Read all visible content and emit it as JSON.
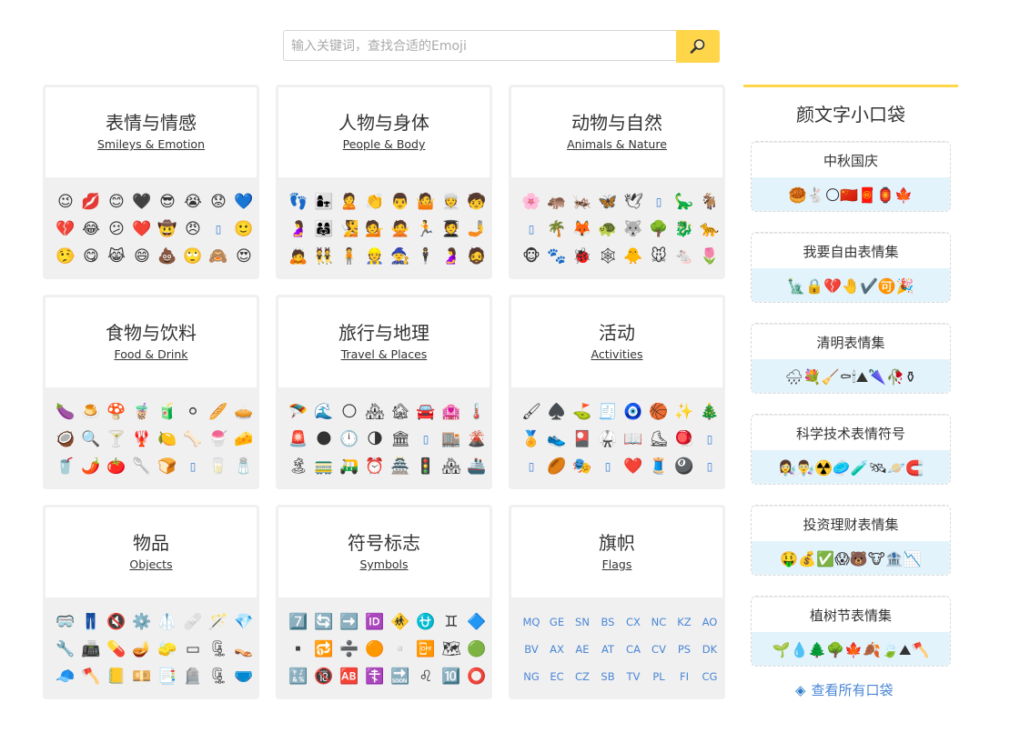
{
  "search": {
    "placeholder": "输入关键词，查找合适的Emoji",
    "button_icon": "magnifier-icon"
  },
  "categories": [
    {
      "title": "表情与情感",
      "sub": "Smileys & Emotion",
      "rows": [
        [
          "😉",
          "💋",
          "😊",
          "🖤",
          "😎",
          "😭",
          "😟",
          "💙"
        ],
        [
          "💔",
          "😂",
          "😕",
          "❤️",
          "🤠",
          "😠",
          "▯",
          "🙂"
        ],
        [
          "🤥",
          "😋",
          "😹",
          "😄",
          "💩",
          "🙄",
          "🙈",
          "😍"
        ]
      ]
    },
    {
      "title": "人物与身体",
      "sub": "People & Body",
      "rows": [
        [
          "👣",
          "👩‍👧",
          "🙎",
          "👏",
          "👨",
          "🤷",
          "👳",
          "🧒"
        ],
        [
          "🤰",
          "👨‍👩‍👧",
          "🧏",
          "💁",
          "🙅",
          "🏃",
          "🧑‍🎓",
          "🤳"
        ],
        [
          "🙇",
          "👯",
          "🧍",
          "👷",
          "🧙",
          "🕴",
          "🤰",
          "🧔"
        ]
      ]
    },
    {
      "title": "动物与自然",
      "sub": "Animals & Nature",
      "rows": [
        [
          "🌸",
          "🦛",
          "🦗",
          "🦋",
          "🕊",
          "▯",
          "🦕",
          "🐐"
        ],
        [
          "▯",
          "🌴",
          "🦊",
          "🐢",
          "🐺",
          "🌳",
          "🐉",
          "🐆"
        ],
        [
          "🐵",
          "🐾",
          "🐞",
          "🕸",
          "🐥",
          "🐭",
          "🐁",
          "🌷"
        ]
      ]
    },
    {
      "title": "食物与饮料",
      "sub": "Food & Drink",
      "rows": [
        [
          "🍆",
          "🍮",
          "🍄",
          "🧋",
          "🧃",
          "⚪",
          "🥖",
          "🥧"
        ],
        [
          "🥥",
          "🔍",
          "🍸",
          "🦞",
          "🍋",
          "🦴",
          "🍧",
          "🧀"
        ],
        [
          "🥤",
          "🌶️",
          "🍅",
          "🥄",
          "🍞",
          "▯",
          "🥛",
          "🧂"
        ]
      ]
    },
    {
      "title": "旅行与地理",
      "sub": "Travel & Places",
      "rows": [
        [
          "🪂",
          "🌊",
          "🌕",
          "🏘",
          "🏚",
          "🚘",
          "🏩",
          "🌡️"
        ],
        [
          "🚨",
          "🌑",
          "🕛",
          "🌗",
          "🏛",
          "▯",
          "🏬",
          "🌋"
        ],
        [
          "🏝",
          "🚃",
          "🛺",
          "⏰",
          "🏯",
          "🚦",
          "🏘",
          "🚢"
        ]
      ]
    },
    {
      "title": "活动",
      "sub": "Activities",
      "rows": [
        [
          "🖌",
          "♠️",
          "⛳",
          "🧾",
          "🧿",
          "🏀",
          "✨",
          "🎄"
        ],
        [
          "🏅",
          "👟",
          "🎴",
          "🥋",
          "📖",
          "⛸",
          "🪀",
          "▯"
        ],
        [
          "▯",
          "🏉",
          "🎭",
          "▯",
          "❤️",
          "🧵",
          "🎱",
          "▯"
        ]
      ]
    },
    {
      "title": "物品",
      "sub": "Objects",
      "rows": [
        [
          "🥽",
          "👖",
          "🔇",
          "⚙️",
          "🥼",
          "🩹",
          "🪄",
          "💎"
        ],
        [
          "🔧",
          "📠",
          "💊",
          "🪔",
          "🧽",
          "▭",
          "🗜",
          "👡"
        ],
        [
          "🧢",
          "🪓",
          "📒",
          "💴",
          "📑",
          "🪦",
          "🗜",
          "🩲"
        ]
      ]
    },
    {
      "title": "符号标志",
      "sub": "Symbols",
      "rows": [
        [
          "7️⃣",
          "🔄",
          "➡️",
          "🆔",
          "🚸",
          "⛎",
          "♊",
          "🔷"
        ],
        [
          "▪️",
          "🔂",
          "➗",
          "🟠",
          "▫️",
          "📴",
          "🗺",
          "🟢"
        ],
        [
          "🔣",
          "🔞",
          "🆎",
          "☦️",
          "🔜",
          "♌",
          "🔟",
          "⭕"
        ]
      ]
    },
    {
      "title": "旗帜",
      "sub": "Flags",
      "codes": [
        [
          "MQ",
          "GE",
          "SN",
          "BS",
          "CX",
          "NC",
          "KZ",
          "AO"
        ],
        [
          "BV",
          "AX",
          "AE",
          "AT",
          "CA",
          "CV",
          "PS",
          "DK"
        ],
        [
          "NG",
          "EC",
          "CZ",
          "SB",
          "TV",
          "PL",
          "FI",
          "CG"
        ]
      ]
    }
  ],
  "sidebar": {
    "title": "颜文字小口袋",
    "pouches": [
      {
        "title": "中秋国庆",
        "emojis": "🥮🐇🌕🇨🇳🧧🏮🍁"
      },
      {
        "title": "我要自由表情集",
        "emojis": "🗽🔒💔🤚✔️🉑🎉"
      },
      {
        "title": "清明表情集",
        "emojis": "🌧💐🧹⚰🕯⛰🌂🥀⚱"
      },
      {
        "title": "科学技术表情符号",
        "emojis": "👩‍🔬👨‍🔬☢️🥏🧪🛰🪐🧲"
      },
      {
        "title": "投资理财表情集",
        "emojis": "🤑💰✅😱🐻🐮🏦📉"
      },
      {
        "title": "植树节表情集",
        "emojis": "🌱💧🌲🌳🍁🍂🍃⛰🪓"
      }
    ],
    "all_link": "查看所有口袋",
    "all_icon": "diamond-dot-icon"
  }
}
